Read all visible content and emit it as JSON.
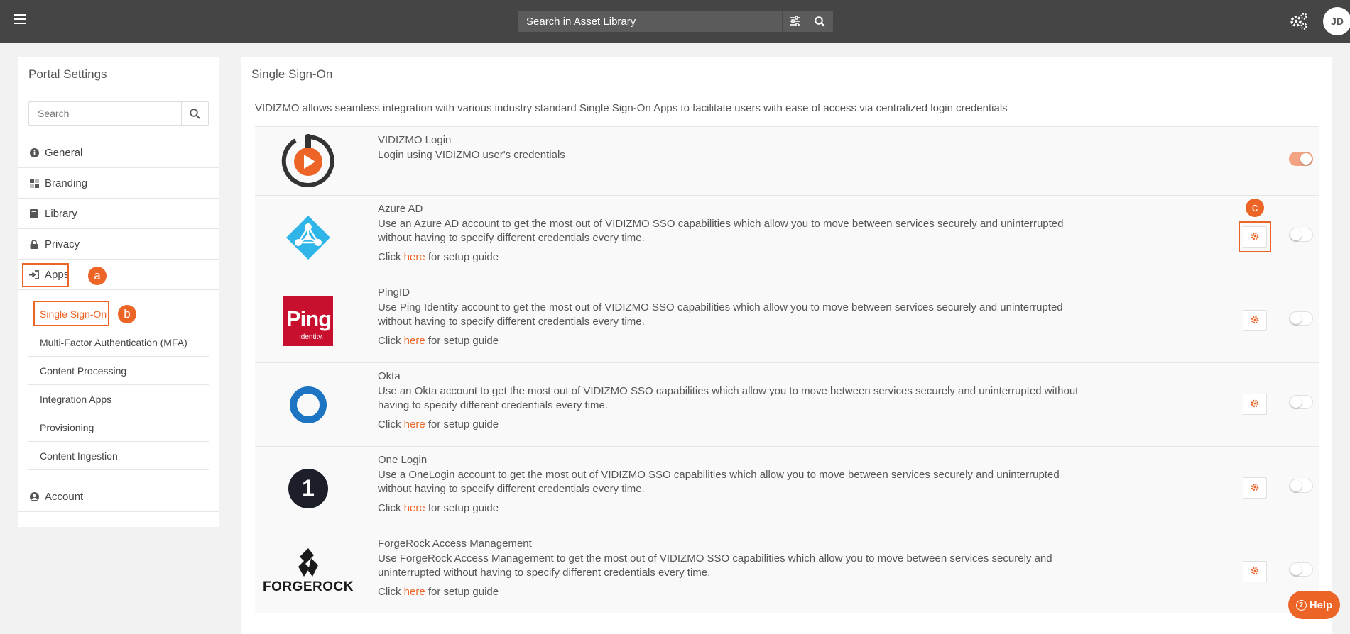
{
  "header": {
    "search_placeholder": "Search in Asset Library",
    "avatar_initials": "JD"
  },
  "sidebar": {
    "title": "Portal Settings",
    "search_placeholder": "Search",
    "items": [
      {
        "label": "General",
        "icon": "info-icon"
      },
      {
        "label": "Branding",
        "icon": "branding-icon"
      },
      {
        "label": "Library",
        "icon": "book-icon"
      },
      {
        "label": "Privacy",
        "icon": "lock-icon"
      },
      {
        "label": "Apps",
        "icon": "sign-in-icon"
      }
    ],
    "sub_items": [
      {
        "label": "Single Sign-On",
        "active": true
      },
      {
        "label": "Multi-Factor Authentication (MFA)"
      },
      {
        "label": "Content Processing"
      },
      {
        "label": "Integration Apps"
      },
      {
        "label": "Provisioning"
      },
      {
        "label": "Content Ingestion"
      }
    ],
    "account": {
      "label": "Account",
      "icon": "user-circle-icon"
    }
  },
  "markers": {
    "a": "a",
    "b": "b",
    "c": "c"
  },
  "main": {
    "title": "Single Sign-On",
    "description": "VIDIZMO allows seamless integration with various industry standard Single Sign-On Apps to facilitate users with ease of access via centralized login credentials",
    "guide_prefix": "Click ",
    "guide_link": "here",
    "guide_suffix": " for setup guide",
    "apps": [
      {
        "name": "VIDIZMO Login",
        "description": "Login using VIDIZMO user's credentials",
        "enabled": true
      },
      {
        "name": "Azure AD",
        "description": "Use an Azure AD account to get the most out of VIDIZMO SSO capabilities which allow you to move between services securely and uninterrupted without having to specify different credentials every time.",
        "enabled": false
      },
      {
        "name": "PingID",
        "description": "Use Ping Identity account to get the most out of VIDIZMO SSO capabilities which allow you to move between services securely and uninterrupted without having to specify different credentials every time.",
        "enabled": false,
        "logo_text": "Ping",
        "logo_subtext": "Identity."
      },
      {
        "name": "Okta",
        "description": "Use an Okta account to get the most out of VIDIZMO SSO capabilities which allow you to move between services securely and uninterrupted without having to specify different credentials every time.",
        "enabled": false
      },
      {
        "name": "One Login",
        "description": "Use a OneLogin account to get the most out of VIDIZMO SSO capabilities which allow you to move between services securely and uninterrupted without having to specify different credentials every time.",
        "enabled": false,
        "logo_text": "1"
      },
      {
        "name": "ForgeRock Access Management",
        "description": "Use ForgeRock Access Management to get the most out of VIDIZMO SSO capabilities which allow you to move between services securely and uninterrupted without having to specify different credentials every time.",
        "enabled": false,
        "logo_text": "FORGEROCK"
      }
    ]
  },
  "help": {
    "label": "Help"
  },
  "colors": {
    "accent": "#ec6426",
    "topbar": "#454545"
  }
}
